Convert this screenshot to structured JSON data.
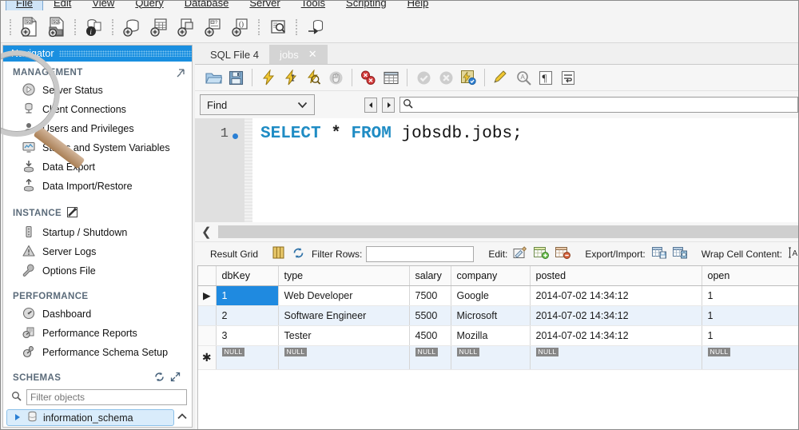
{
  "menu": {
    "items": [
      "File",
      "Edit",
      "View",
      "Query",
      "Database",
      "Server",
      "Tools",
      "Scripting",
      "Help"
    ],
    "active": "File"
  },
  "main_toolbar": {
    "buttons": [
      {
        "name": "new-sql-file-icon",
        "label": "New SQL File"
      },
      {
        "name": "open-sql-file-icon",
        "label": "Open SQL Script"
      },
      {
        "name": "connection-info-icon",
        "label": "Connection Info"
      },
      {
        "name": "new-schema-icon",
        "label": "Create New Schema"
      },
      {
        "name": "new-table-icon",
        "label": "Create New Table"
      },
      {
        "name": "new-view-icon",
        "label": "Create New View"
      },
      {
        "name": "new-procedure-icon",
        "label": "Create New Stored Procedure"
      },
      {
        "name": "new-function-icon",
        "label": "Create New Function"
      },
      {
        "name": "search-data-icon",
        "label": "Search Table Data"
      },
      {
        "name": "reconnect-icon",
        "label": "Reconnect to DBMS"
      }
    ]
  },
  "navigator": {
    "title": "Navigator",
    "pin_icon": "pin-icon",
    "groups": [
      {
        "header": "MANAGEMENT",
        "items": [
          {
            "label": "Server Status",
            "icon": "server-status-icon"
          },
          {
            "label": "Client Connections",
            "icon": "client-connections-icon"
          },
          {
            "label": "Users and Privileges",
            "icon": "users-privileges-icon"
          },
          {
            "label": "Status and System Variables",
            "icon": "status-variables-icon"
          },
          {
            "label": "Data Export",
            "icon": "data-export-icon"
          },
          {
            "label": "Data Import/Restore",
            "icon": "data-import-icon"
          }
        ]
      },
      {
        "header": "INSTANCE",
        "header_icon": "instance-icon",
        "items": [
          {
            "label": "Startup / Shutdown",
            "icon": "startup-shutdown-icon"
          },
          {
            "label": "Server Logs",
            "icon": "server-logs-icon"
          },
          {
            "label": "Options File",
            "icon": "options-file-icon"
          }
        ]
      },
      {
        "header": "PERFORMANCE",
        "items": [
          {
            "label": "Dashboard",
            "icon": "dashboard-icon"
          },
          {
            "label": "Performance Reports",
            "icon": "performance-reports-icon"
          },
          {
            "label": "Performance Schema Setup",
            "icon": "performance-schema-icon"
          }
        ]
      }
    ],
    "schemas": {
      "header": "SCHEMAS",
      "refresh_icon": "refresh-icon",
      "expand_icon": "expand-icon",
      "filter_placeholder": "Filter objects",
      "filter_value": "",
      "search_icon": "search-icon",
      "items": [
        {
          "label": "information_schema",
          "selected": true,
          "expand_icon": "triangle-right-icon",
          "icon": "schema-icon"
        }
      ],
      "scroll_icon": "chevron-up-icon"
    }
  },
  "tabs": [
    {
      "label": "SQL File 4",
      "active": false,
      "closable": false
    },
    {
      "label": "jobs",
      "active": true,
      "closable": true,
      "close_icon": "close-icon"
    }
  ],
  "sql_toolbar": {
    "buttons": [
      {
        "name": "open-file-icon",
        "label": "Open a script file in this editor"
      },
      {
        "name": "save-icon",
        "label": "Save the script to a file"
      },
      {
        "name": "execute-icon",
        "label": "Execute the selected portion"
      },
      {
        "name": "execute-current-icon",
        "label": "Execute the statement under the keyboard cursor"
      },
      {
        "name": "explain-icon",
        "label": "Execute Explain statement"
      },
      {
        "name": "stop-icon",
        "label": "Stop the query being executed"
      },
      {
        "name": "toggle-breakpoint-icon",
        "label": "Toggle whether execution should stop on errors"
      },
      {
        "name": "results-grid-icon",
        "label": "Toggle Results Grid"
      },
      {
        "name": "commit-icon",
        "label": "Commit"
      },
      {
        "name": "rollback-icon",
        "label": "Rollback"
      },
      {
        "name": "autocommit-icon",
        "label": "Toggle Auto-Commit Mode"
      },
      {
        "name": "beautify-icon",
        "label": "Beautify/reformat the SQL script"
      },
      {
        "name": "find-icon",
        "label": "Find"
      },
      {
        "name": "invisible-chars-icon",
        "label": "Toggle invisible characters"
      },
      {
        "name": "wrap-lines-icon",
        "label": "Toggle wrapping of long lines"
      }
    ]
  },
  "find_bar": {
    "mode_label": "Find",
    "mode_chevron": "chevron-down-icon",
    "prev_icon": "nav-prev-icon",
    "next_icon": "nav-next-icon",
    "search_icon": "search-icon",
    "search_value": "",
    "search_placeholder": ""
  },
  "editor": {
    "line_number": "1",
    "statement_marker": "blue-dot-icon",
    "code_tokens": [
      {
        "text": "SELECT",
        "type": "keyword"
      },
      {
        "text": " ",
        "type": "plain"
      },
      {
        "text": "*",
        "type": "operator"
      },
      {
        "text": " ",
        "type": "plain"
      },
      {
        "text": "FROM",
        "type": "keyword"
      },
      {
        "text": " ",
        "type": "plain"
      },
      {
        "text": "jobsdb.jobs;",
        "type": "identifier"
      }
    ],
    "code_text": "SELECT * FROM jobsdb.jobs;"
  },
  "collapse_bar": {
    "chevron": "chevron-left-icon"
  },
  "result_toolbar": {
    "result_grid_label": "Result Grid",
    "grid_view_icon": "grid-view-icon",
    "refresh_icon": "refresh-icon",
    "filter_rows_label": "Filter Rows:",
    "filter_rows_value": "",
    "edit_label": "Edit:",
    "edit_icons": [
      "edit-pencil-icon",
      "insert-row-icon",
      "delete-row-icon"
    ],
    "export_import_label": "Export/Import:",
    "export_import_icons": [
      "export-icon",
      "import-icon"
    ],
    "wrap_cell_label": "Wrap Cell Content:",
    "wrap_cell_icon": "wrap-cell-icon"
  },
  "result_grid": {
    "columns": [
      "dbKey",
      "type",
      "salary",
      "company",
      "posted",
      "open"
    ],
    "rows": [
      {
        "marker": "row-marker-icon",
        "cells": [
          "1",
          "Web Developer",
          "7500",
          "Google",
          "2014-07-02 14:34:12",
          "1"
        ],
        "selected_cell": 0
      },
      {
        "marker": "",
        "cells": [
          "2",
          "Software Engineer",
          "5500",
          "Microsoft",
          "2014-07-02 14:34:12",
          "1"
        ],
        "selected_cell": -1
      },
      {
        "marker": "",
        "cells": [
          "3",
          "Tester",
          "4500",
          "Mozilla",
          "2014-07-02 14:34:12",
          "1"
        ],
        "selected_cell": -1
      }
    ],
    "new_row": {
      "marker": "asterisk-icon",
      "null_label": "NULL",
      "cells": [
        "NULL",
        "NULL",
        "NULL",
        "NULL",
        "NULL",
        "NULL"
      ]
    }
  },
  "colors": {
    "accent": "#1a8fe0",
    "selection": "#1f8ae0",
    "alt_row": "#eaf2fb",
    "keyword": "#1f8cc4",
    "null_badge": "#878787"
  }
}
